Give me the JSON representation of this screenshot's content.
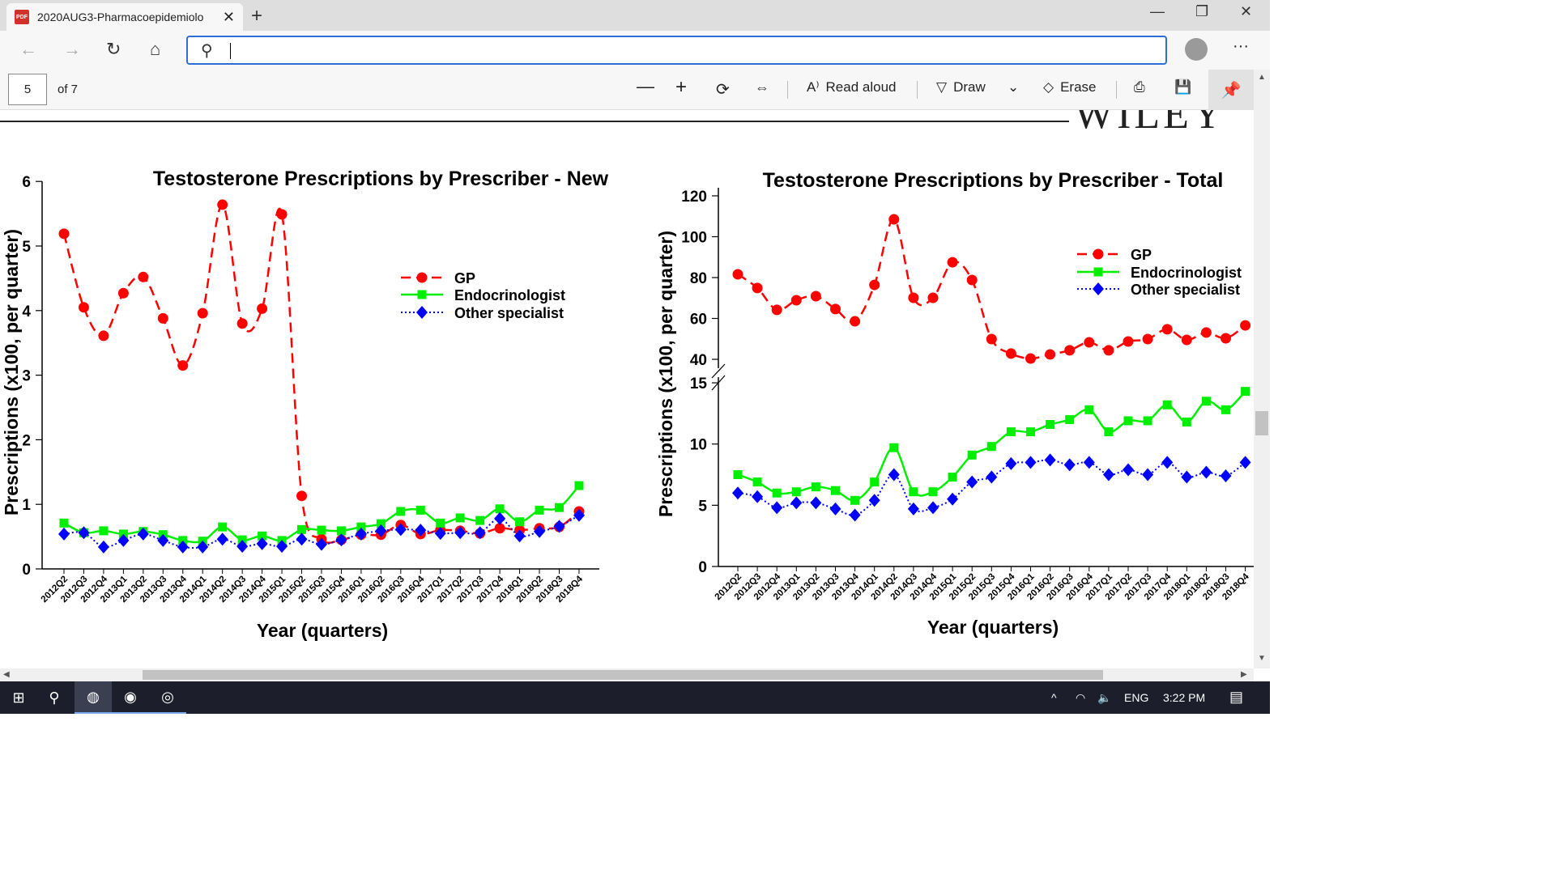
{
  "browser": {
    "tab_title": "2020AUG3-Pharmacoepidemiolo",
    "tab_icon": "pdf-icon",
    "address_value": "",
    "icons": [
      "back-icon",
      "forward-icon",
      "refresh-icon",
      "home-icon",
      "search-icon",
      "profile-icon",
      "more-icon"
    ]
  },
  "pdf_toolbar": {
    "page": "5",
    "of_pages": "of 7",
    "read_aloud": "Read aloud",
    "draw": "Draw",
    "erase": "Erase"
  },
  "document": {
    "logo_text": "WILEY"
  },
  "taskbar": {
    "language": "ENG",
    "time": "3:22 PM"
  },
  "chart_data": [
    {
      "type": "line",
      "title": "Testosterone Prescriptions by Prescriber - New",
      "xlabel": "Year (quarters)",
      "ylabel": "Prescriptions (x100, per quarter)",
      "ylim": [
        0,
        6
      ],
      "yticks": [
        "0",
        "1",
        "2",
        "3",
        "4",
        "5",
        "6"
      ],
      "legend": "top-right",
      "categories": [
        "2012Q2",
        "2012Q3",
        "2012Q4",
        "2013Q1",
        "2013Q2",
        "2013Q3",
        "2013Q4",
        "2014Q1",
        "2014Q2",
        "2014Q3",
        "2014Q4",
        "2015Q1",
        "2015Q2",
        "2015Q3",
        "2015Q4",
        "2016Q1",
        "2016Q2",
        "2016Q3",
        "2016Q4",
        "2017Q1",
        "2017Q2",
        "2017Q3",
        "2017Q4",
        "2018Q1",
        "2018Q2",
        "2018Q3",
        "2018Q4"
      ],
      "series": [
        {
          "name": "GP",
          "color": "#ff0000",
          "marker": "circle",
          "dash": "dashed",
          "values": [
            5.19,
            4.05,
            3.61,
            4.27,
            4.52,
            3.88,
            3.15,
            3.96,
            5.64,
            3.8,
            4.03,
            5.49,
            1.13,
            0.46,
            0.45,
            0.53,
            0.53,
            0.68,
            0.54,
            0.6,
            0.59,
            0.55,
            0.63,
            0.6,
            0.63,
            0.65,
            0.89
          ]
        },
        {
          "name": "Endocrinologist",
          "color": "#00ee00",
          "marker": "square",
          "dash": "solid",
          "values": [
            0.71,
            0.56,
            0.59,
            0.54,
            0.58,
            0.53,
            0.44,
            0.43,
            0.65,
            0.45,
            0.51,
            0.44,
            0.61,
            0.6,
            0.59,
            0.65,
            0.7,
            0.89,
            0.91,
            0.71,
            0.79,
            0.75,
            0.93,
            0.73,
            0.91,
            0.95,
            1.29
          ]
        },
        {
          "name": "Other specialist",
          "color": "#0000ff",
          "marker": "diamond",
          "dash": "dotted",
          "values": [
            0.54,
            0.56,
            0.34,
            0.44,
            0.54,
            0.44,
            0.34,
            0.34,
            0.46,
            0.35,
            0.39,
            0.35,
            0.46,
            0.38,
            0.45,
            0.54,
            0.59,
            0.61,
            0.6,
            0.55,
            0.56,
            0.56,
            0.78,
            0.51,
            0.58,
            0.66,
            0.83
          ]
        }
      ]
    },
    {
      "type": "line",
      "title": "Testosterone Prescriptions by Prescriber - Total",
      "xlabel": "Year (quarters)",
      "ylabel": "Prescriptions (x100, per quarter)",
      "y_axis_break": true,
      "ylim_lower": [
        0,
        15
      ],
      "ylim_upper": [
        40,
        120
      ],
      "yticks": [
        "0",
        "5",
        "10",
        "15",
        "40",
        "60",
        "80",
        "100",
        "120"
      ],
      "legend": "top-right",
      "categories": [
        "2012Q2",
        "2012Q3",
        "2012Q4",
        "2013Q1",
        "2013Q2",
        "2013Q3",
        "2013Q4",
        "2014Q1",
        "2014Q2",
        "2014Q3",
        "2014Q4",
        "2015Q1",
        "2015Q2",
        "2015Q3",
        "2015Q4",
        "2016Q1",
        "2016Q2",
        "2016Q3",
        "2016Q4",
        "2017Q1",
        "2017Q2",
        "2017Q3",
        "2017Q4",
        "2018Q1",
        "2018Q2",
        "2018Q3",
        "2018Q4"
      ],
      "series": [
        {
          "name": "GP",
          "color": "#ff0000",
          "marker": "circle",
          "dash": "dashed",
          "values": [
            81.6,
            74.9,
            64.2,
            68.9,
            70.9,
            64.6,
            58.6,
            76.4,
            108.5,
            70.1,
            70.1,
            87.5,
            78.8,
            49.9,
            42.8,
            40.4,
            42.4,
            44.4,
            48.3,
            44.4,
            48.7,
            49.9,
            54.7,
            49.5,
            53.1,
            50.3,
            56.6
          ]
        },
        {
          "name": "Endocrinologist",
          "color": "#00ee00",
          "marker": "square",
          "dash": "solid",
          "values": [
            7.5,
            6.9,
            6.0,
            6.1,
            6.5,
            6.2,
            5.4,
            6.9,
            9.7,
            6.1,
            6.1,
            7.3,
            9.1,
            9.8,
            11.0,
            11.0,
            11.6,
            12.0,
            12.8,
            11.0,
            11.9,
            11.9,
            13.2,
            11.8,
            13.5,
            12.8,
            14.3
          ]
        },
        {
          "name": "Other specialist",
          "color": "#0000ff",
          "marker": "diamond",
          "dash": "dotted",
          "values": [
            6.0,
            5.7,
            4.8,
            5.2,
            5.2,
            4.7,
            4.2,
            5.4,
            7.5,
            4.7,
            4.8,
            5.5,
            6.9,
            7.3,
            8.4,
            8.5,
            8.7,
            8.3,
            8.5,
            7.5,
            7.9,
            7.5,
            8.5,
            7.3,
            7.7,
            7.4,
            8.5
          ]
        }
      ]
    }
  ]
}
